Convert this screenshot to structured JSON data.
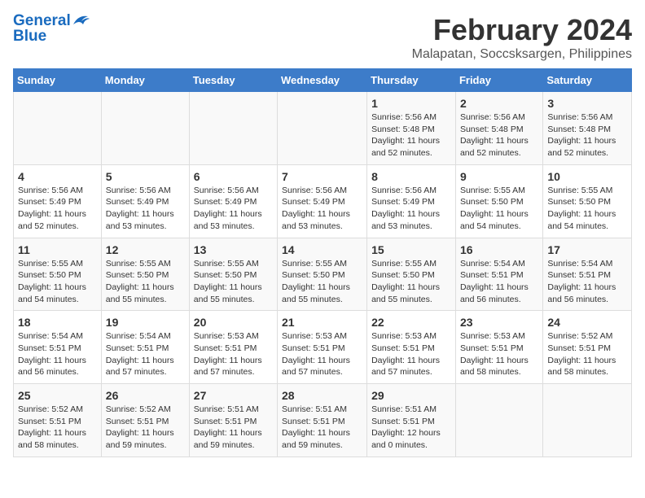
{
  "header": {
    "logo_line1": "General",
    "logo_line2": "Blue",
    "month_title": "February 2024",
    "location": "Malapatan, Soccsksargen, Philippines"
  },
  "weekdays": [
    "Sunday",
    "Monday",
    "Tuesday",
    "Wednesday",
    "Thursday",
    "Friday",
    "Saturday"
  ],
  "weeks": [
    [
      {
        "day": "",
        "info": ""
      },
      {
        "day": "",
        "info": ""
      },
      {
        "day": "",
        "info": ""
      },
      {
        "day": "",
        "info": ""
      },
      {
        "day": "1",
        "info": "Sunrise: 5:56 AM\nSunset: 5:48 PM\nDaylight: 11 hours\nand 52 minutes."
      },
      {
        "day": "2",
        "info": "Sunrise: 5:56 AM\nSunset: 5:48 PM\nDaylight: 11 hours\nand 52 minutes."
      },
      {
        "day": "3",
        "info": "Sunrise: 5:56 AM\nSunset: 5:48 PM\nDaylight: 11 hours\nand 52 minutes."
      }
    ],
    [
      {
        "day": "4",
        "info": "Sunrise: 5:56 AM\nSunset: 5:49 PM\nDaylight: 11 hours\nand 52 minutes."
      },
      {
        "day": "5",
        "info": "Sunrise: 5:56 AM\nSunset: 5:49 PM\nDaylight: 11 hours\nand 53 minutes."
      },
      {
        "day": "6",
        "info": "Sunrise: 5:56 AM\nSunset: 5:49 PM\nDaylight: 11 hours\nand 53 minutes."
      },
      {
        "day": "7",
        "info": "Sunrise: 5:56 AM\nSunset: 5:49 PM\nDaylight: 11 hours\nand 53 minutes."
      },
      {
        "day": "8",
        "info": "Sunrise: 5:56 AM\nSunset: 5:49 PM\nDaylight: 11 hours\nand 53 minutes."
      },
      {
        "day": "9",
        "info": "Sunrise: 5:55 AM\nSunset: 5:50 PM\nDaylight: 11 hours\nand 54 minutes."
      },
      {
        "day": "10",
        "info": "Sunrise: 5:55 AM\nSunset: 5:50 PM\nDaylight: 11 hours\nand 54 minutes."
      }
    ],
    [
      {
        "day": "11",
        "info": "Sunrise: 5:55 AM\nSunset: 5:50 PM\nDaylight: 11 hours\nand 54 minutes."
      },
      {
        "day": "12",
        "info": "Sunrise: 5:55 AM\nSunset: 5:50 PM\nDaylight: 11 hours\nand 55 minutes."
      },
      {
        "day": "13",
        "info": "Sunrise: 5:55 AM\nSunset: 5:50 PM\nDaylight: 11 hours\nand 55 minutes."
      },
      {
        "day": "14",
        "info": "Sunrise: 5:55 AM\nSunset: 5:50 PM\nDaylight: 11 hours\nand 55 minutes."
      },
      {
        "day": "15",
        "info": "Sunrise: 5:55 AM\nSunset: 5:50 PM\nDaylight: 11 hours\nand 55 minutes."
      },
      {
        "day": "16",
        "info": "Sunrise: 5:54 AM\nSunset: 5:51 PM\nDaylight: 11 hours\nand 56 minutes."
      },
      {
        "day": "17",
        "info": "Sunrise: 5:54 AM\nSunset: 5:51 PM\nDaylight: 11 hours\nand 56 minutes."
      }
    ],
    [
      {
        "day": "18",
        "info": "Sunrise: 5:54 AM\nSunset: 5:51 PM\nDaylight: 11 hours\nand 56 minutes."
      },
      {
        "day": "19",
        "info": "Sunrise: 5:54 AM\nSunset: 5:51 PM\nDaylight: 11 hours\nand 57 minutes."
      },
      {
        "day": "20",
        "info": "Sunrise: 5:53 AM\nSunset: 5:51 PM\nDaylight: 11 hours\nand 57 minutes."
      },
      {
        "day": "21",
        "info": "Sunrise: 5:53 AM\nSunset: 5:51 PM\nDaylight: 11 hours\nand 57 minutes."
      },
      {
        "day": "22",
        "info": "Sunrise: 5:53 AM\nSunset: 5:51 PM\nDaylight: 11 hours\nand 57 minutes."
      },
      {
        "day": "23",
        "info": "Sunrise: 5:53 AM\nSunset: 5:51 PM\nDaylight: 11 hours\nand 58 minutes."
      },
      {
        "day": "24",
        "info": "Sunrise: 5:52 AM\nSunset: 5:51 PM\nDaylight: 11 hours\nand 58 minutes."
      }
    ],
    [
      {
        "day": "25",
        "info": "Sunrise: 5:52 AM\nSunset: 5:51 PM\nDaylight: 11 hours\nand 58 minutes."
      },
      {
        "day": "26",
        "info": "Sunrise: 5:52 AM\nSunset: 5:51 PM\nDaylight: 11 hours\nand 59 minutes."
      },
      {
        "day": "27",
        "info": "Sunrise: 5:51 AM\nSunset: 5:51 PM\nDaylight: 11 hours\nand 59 minutes."
      },
      {
        "day": "28",
        "info": "Sunrise: 5:51 AM\nSunset: 5:51 PM\nDaylight: 11 hours\nand 59 minutes."
      },
      {
        "day": "29",
        "info": "Sunrise: 5:51 AM\nSunset: 5:51 PM\nDaylight: 12 hours\nand 0 minutes."
      },
      {
        "day": "",
        "info": ""
      },
      {
        "day": "",
        "info": ""
      }
    ]
  ]
}
